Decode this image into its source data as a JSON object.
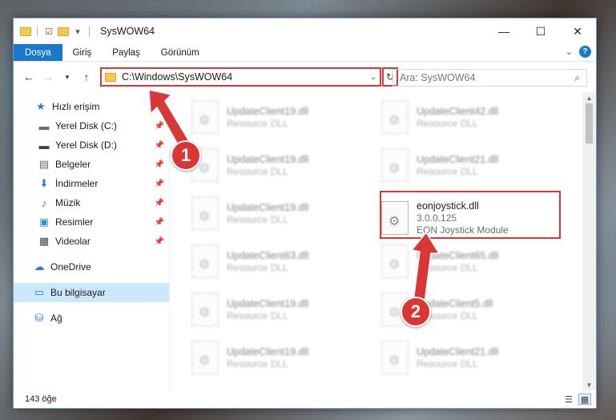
{
  "window": {
    "title": "SysWOW64",
    "controls": {
      "minimize": "—",
      "maximize": "☐",
      "close": "✕"
    }
  },
  "ribbon": {
    "tabs": [
      "Dosya",
      "Giriş",
      "Paylaş",
      "Görünüm"
    ],
    "expand": "⌄",
    "help": "?"
  },
  "addressbar": {
    "path": "C:\\Windows\\SysWOW64",
    "search_placeholder": "Ara: SysWOW64"
  },
  "sidebar": {
    "items": [
      {
        "label": "Hızlı erişim",
        "icon": "star-icon",
        "glyph": "★",
        "color": "#2f7bd6",
        "pinned": false
      },
      {
        "label": "Yerel Disk (C:)",
        "icon": "drive-icon",
        "glyph": "▬",
        "color": "#5a6e84",
        "pinned": true
      },
      {
        "label": "Yerel Disk (D:)",
        "icon": "drive-icon",
        "glyph": "▬",
        "color": "#444",
        "pinned": true
      },
      {
        "label": "Belgeler",
        "icon": "document-icon",
        "glyph": "▤",
        "color": "#5b6b7c",
        "pinned": true
      },
      {
        "label": "İndirmeler",
        "icon": "download-icon",
        "glyph": "⬇",
        "color": "#2f7bd6",
        "pinned": true
      },
      {
        "label": "Müzik",
        "icon": "music-icon",
        "glyph": "♪",
        "color": "#2f7bd6",
        "pinned": true
      },
      {
        "label": "Resimler",
        "icon": "pictures-icon",
        "glyph": "▣",
        "color": "#2f8fcf",
        "pinned": true
      },
      {
        "label": "Videolar",
        "icon": "video-icon",
        "glyph": "▦",
        "color": "#444",
        "pinned": true
      },
      {
        "label": "OneDrive",
        "icon": "cloud-icon",
        "glyph": "☁",
        "color": "#2f7bd6",
        "pinned": false
      },
      {
        "label": "Bu bilgisayar",
        "icon": "computer-icon",
        "glyph": "▭",
        "color": "#2f7bd6",
        "pinned": false,
        "selected": true
      },
      {
        "label": "Ağ",
        "icon": "network-icon",
        "glyph": "⛁",
        "color": "#2f7bd6",
        "pinned": false
      }
    ]
  },
  "files": {
    "left": [
      {
        "name": "UpdateClient19.dll",
        "type": "Resource DLL"
      },
      {
        "name": "UpdateClient19.dll",
        "type": "Resource DLL"
      },
      {
        "name": "UpdateClient19.dll",
        "type": "Resource DLL"
      },
      {
        "name": "UpdateClient63.dll",
        "type": "Resource DLL"
      },
      {
        "name": "UpdateClient19.dll",
        "type": "Resource DLL"
      },
      {
        "name": "UpdateClient19.dll",
        "type": "Resource DLL"
      }
    ],
    "right": [
      {
        "name": "UpdateClient42.dll",
        "type": "Resource DLL"
      },
      {
        "name": "UpdateClient21.dll",
        "type": "Resource DLL"
      },
      {
        "name": "eonjoystick.dll",
        "version": "3.0.0.125",
        "type": "EON Joystick Module",
        "highlighted": true
      },
      {
        "name": "UpdateClient65.dll",
        "type": "Resource DLL"
      },
      {
        "name": "UpdateClient5.dll",
        "type": "Resource DLL"
      },
      {
        "name": "UpdateClient21.dll",
        "type": "Resource DLL"
      }
    ]
  },
  "annotations": {
    "step1": "1",
    "step2": "2",
    "color": "#d93636"
  },
  "status": {
    "count": "143 öğe"
  }
}
